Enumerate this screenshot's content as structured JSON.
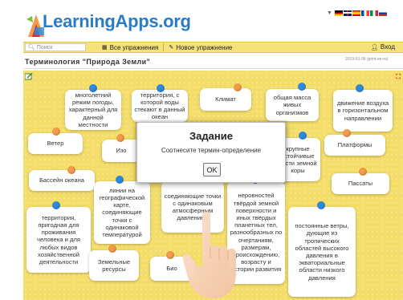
{
  "header": {
    "logo_text": "LearningApps.org",
    "flags": [
      "#c8102e",
      "#c8102e",
      "#ffce00",
      "#009246",
      "#0055a4",
      "#b22234"
    ]
  },
  "toolbar": {
    "search_placeholder": "Поиск",
    "all_exercises_label": "Все упражнения",
    "new_exercise_label": "Новое упражнение",
    "login_label": "Вход"
  },
  "page": {
    "title": "Терминология \"Природа Земли\"",
    "date": "2019-01-05 (print-en-ru)"
  },
  "cards": [
    {
      "id": "c1",
      "text": "многолетний режим погоды, характерный для данной местности",
      "pin": "blue"
    },
    {
      "id": "c2",
      "text": "территория, с которой воды стекают в данный океан",
      "pin": "blue"
    },
    {
      "id": "c3",
      "text": "Климат",
      "pin": "orange"
    },
    {
      "id": "c4",
      "text": "общая масса живых организмов",
      "pin": "blue"
    },
    {
      "id": "c5",
      "text": "движение воздуха в горизонтальном направлении",
      "pin": "blue"
    },
    {
      "id": "c6",
      "text": "Ветер",
      "pin": "orange"
    },
    {
      "id": "c7",
      "text": "Изо",
      "pin": "orange"
    },
    {
      "id": "c8",
      "text": "крупные устойчивые части земной коры",
      "pin": "blue"
    },
    {
      "id": "c9",
      "text": "Платформы",
      "pin": "orange"
    },
    {
      "id": "c10",
      "text": "Бассейн океана",
      "pin": "orange"
    },
    {
      "id": "c11",
      "text": "линии на географической карте, соединяющие точки с одинаковой температурой",
      "pin": "blue"
    },
    {
      "id": "c12",
      "text": "соединяющие точки с одинаковым атмосферным давлением",
      "pin": "blue"
    },
    {
      "id": "c13",
      "text": "неровностей твёрдой земной поверхности и иных твёрдых планетных тел, разнообразных по очертаниям, размерам, происхождению, возрасту и истории развития",
      "pin": "blue"
    },
    {
      "id": "c14",
      "text": "Пассаты",
      "pin": "orange"
    },
    {
      "id": "c15",
      "text": "территория, пригодная для проживания человека и для любых видов хозяйственной деятельности",
      "pin": "blue"
    },
    {
      "id": "c16",
      "text": "Земельные ресурсы",
      "pin": "orange"
    },
    {
      "id": "c17",
      "text": "Био",
      "pin": "orange"
    },
    {
      "id": "c18",
      "text": "постоянные ветры, дующие из тропических областей высокого давления в экваториальные области низкого давления",
      "pin": "blue"
    }
  ],
  "modal": {
    "title": "Задание",
    "text": "Соотнесите термин-определение",
    "ok_label": "OK"
  },
  "board_expand_label": "⛶"
}
